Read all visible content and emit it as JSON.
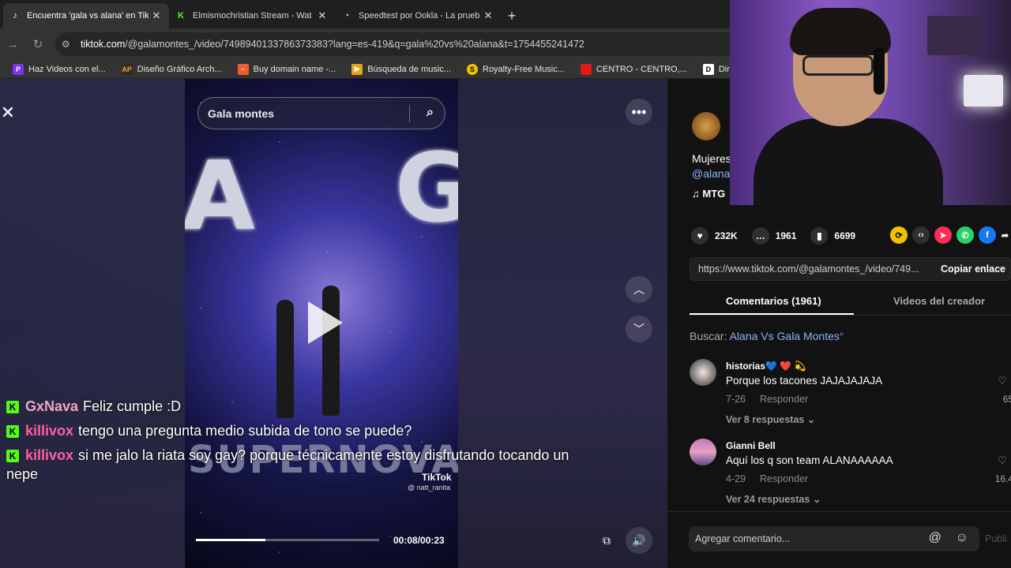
{
  "browser": {
    "tabs": [
      {
        "title": "Encuentra 'gala vs alana' en Tik",
        "favicon": "tiktok-icon",
        "active": true
      },
      {
        "title": "Elmismochristian Stream - Wat",
        "favicon": "kick-icon",
        "active": false
      },
      {
        "title": "Speedtest por Ookla - La prueb",
        "favicon": "speedtest-icon",
        "active": false
      }
    ],
    "url_domain": "tiktok.com",
    "url_path": "/@galamontes_/video/7498940133786373383?lang=es-419&q=gala%20vs%20alana&t=1754455241472",
    "bookmarks": [
      {
        "label": "Haz Videos con el...",
        "color": "#7b2ff7",
        "glyph": "P"
      },
      {
        "label": "Diseño Gráfico Arch...",
        "color": "#2b2b2b",
        "glyph": "AP"
      },
      {
        "label": "Buy domain name -...",
        "color": "#f25c2a",
        "glyph": "~"
      },
      {
        "label": "Búsqueda de music...",
        "color": "#e8a317",
        "glyph": "▶"
      },
      {
        "label": "Royalty-Free Music...",
        "color": "#f2c200",
        "glyph": "S"
      },
      {
        "label": "CENTRO - CENTRO,...",
        "color": "#e01b1b",
        "glyph": ""
      },
      {
        "label": "Direct Liquidat",
        "color": "#ffffff",
        "glyph": "D"
      }
    ]
  },
  "video": {
    "search_text": "Gala montes",
    "tiktok_logo": "TikTok",
    "handle": "@ natt_ranita",
    "banner": "SUPERNOVA",
    "time": "00:08/00:23",
    "progress": 0.38
  },
  "chat": [
    {
      "user": "GxNava",
      "color": "#f0a7c6",
      "message": "Feliz cumple :D"
    },
    {
      "user": "killivox",
      "color": "#ff5fa0",
      "message": "tengo una pregunta medio subida de tono se puede?"
    },
    {
      "user": "killivox",
      "color": "#ff5fa0",
      "message": "si me jalo la riata soy gay? porque técnicamente estoy disfrutando tocando un nepe"
    }
  ],
  "post": {
    "desc_line1": "Mujeres",
    "desc_line2": "@alana",
    "music": "♫  MTG",
    "likes": "232K",
    "comments": "1961",
    "saves": "6699",
    "share_url": "https://www.tiktok.com/@galamontes_/video/749...",
    "copy_label": "Copiar enlace"
  },
  "tabs": {
    "comments": "Comentarios (1961)",
    "creator": "Videos del creador"
  },
  "search_suggest": {
    "label": "Buscar:",
    "query": "Alana Vs Gala Montes"
  },
  "comments": [
    {
      "user": "historias💙 ❤️ 💫",
      "text": "Porque los tacones JAJAJAJAJA",
      "date": "7-26",
      "reply": "Responder",
      "replies": "Ver 8 respuestas",
      "likes": "65"
    },
    {
      "user": "Gianni Bell",
      "text": "Aquí los q son team ALANAAAAAA",
      "date": "4-29",
      "reply": "Responder",
      "replies": "Ver 24 respuestas",
      "likes": "16.4"
    }
  ],
  "comment_input": {
    "placeholder": "Agregar comentario...",
    "publish": "Publi"
  }
}
